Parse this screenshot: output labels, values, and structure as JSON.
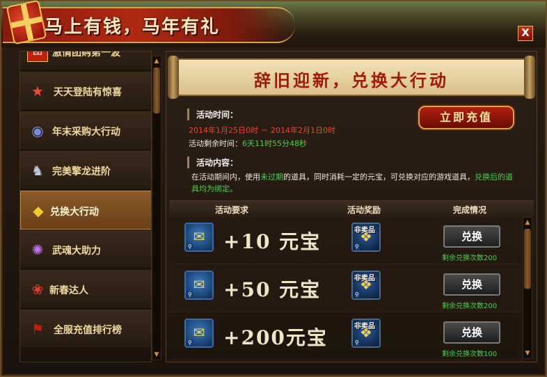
{
  "window": {
    "title": "马上有钱，马年有礼",
    "close_label": "X"
  },
  "sidebar": {
    "items": [
      {
        "label": "激情团购第一波",
        "icon": "团"
      },
      {
        "label": "天天登陆有惊喜",
        "icon": "★"
      },
      {
        "label": "年末采购大行动",
        "icon": "◉"
      },
      {
        "label": "完美擎龙进阶",
        "icon": "♞"
      },
      {
        "label": "兑换大行动",
        "icon": "◆"
      },
      {
        "label": "武魂大助力",
        "icon": "✺"
      },
      {
        "label": "新春达人",
        "icon": "❀"
      },
      {
        "label": "全服充值排行榜",
        "icon": "⚑"
      }
    ],
    "active_index": 4
  },
  "main": {
    "banner": "辞旧迎新，兑换大行动",
    "time_label": "活动时间：",
    "time_range": "2014年1月25日0时 － 2014年2月1日0时",
    "remaining_prefix": "活动剩余时间：",
    "remaining_value": "6天11时55分48秒",
    "recharge_label": "立即充值",
    "content_label": "活动内容：",
    "desc_1": "在活动期间内，使用",
    "desc_highlight_1": "未过期",
    "desc_2": "的道具，同时消耗一定的元宝，可兑换对应的游戏道具，",
    "desc_highlight_2": "兑换后的道具均为绑定。",
    "columns": [
      "活动要求",
      "活动奖励",
      "完成情况"
    ],
    "rows": [
      {
        "requirement": "+10 元宝",
        "nosale": "非卖品",
        "button": "兑换",
        "remaining": "剩余兑换次数200"
      },
      {
        "requirement": "+50 元宝",
        "nosale": "非卖品",
        "button": "兑换",
        "remaining": "剩余兑换次数200"
      },
      {
        "requirement": "+200元宝",
        "nosale": "非卖品",
        "button": "兑换",
        "remaining": "剩余兑换次数100"
      }
    ]
  },
  "colors": {
    "remaining_time": "#4ad34a",
    "date_text": "#e84a2a",
    "highlight_green": "#4ad34a",
    "banner_text": "#a01808"
  }
}
